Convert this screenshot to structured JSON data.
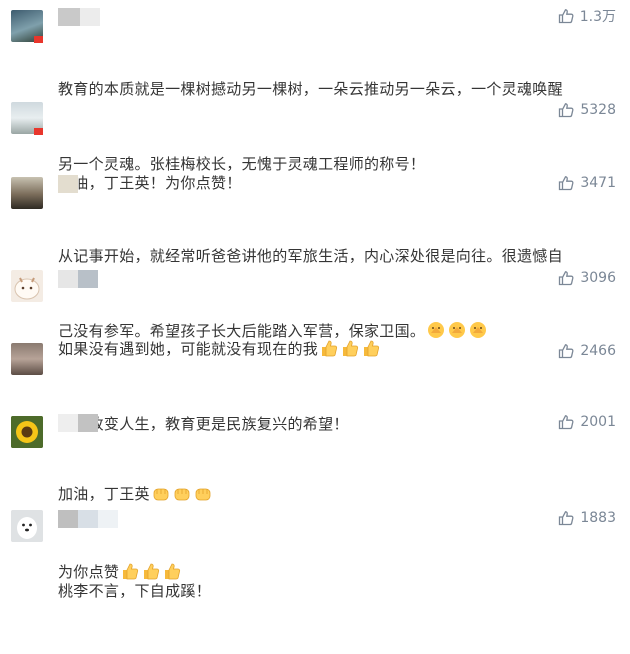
{
  "comments": [
    {
      "likes": "1.3万",
      "text": "教育的本质就是一棵树撼动另一棵树，一朵云推动另一朵云，一个灵魂唤醒另一个灵魂。张桂梅校长，无愧于灵魂工程师的称号！",
      "line1": "教育的本质就是一棵树撼动另一棵树，一朵云推动另一朵云，一个灵魂唤醒",
      "line2": "另一个灵魂。张桂梅校长，无愧于灵魂工程师的称号！"
    },
    {
      "likes": "5328",
      "line1": "加油，丁王英！为你点赞！"
    },
    {
      "likes": "3471",
      "line1": "从记事开始，就经常听爸爸讲他的军旅生活，内心深处很是向往。很遗憾自",
      "line2": "己没有参军。希望孩子长大后能踏入军营，保家卫国。",
      "emoji": "pray-emoji"
    },
    {
      "likes": "3096",
      "line1": "如果没有遇到她，可能就没有现在的我",
      "emoji": "thumbs-up-emoji"
    },
    {
      "likes": "2466",
      "line1": "教育改变人生，教育更是民族复兴的希望！"
    },
    {
      "likes": "2001",
      "line1": "加油，丁王英",
      "line2": "为你点赞",
      "emoji1": "fist-emoji",
      "emoji2": "thumbs-up-emoji"
    },
    {
      "likes": "1883",
      "line1": "桃李不言，下自成蹊！"
    }
  ],
  "colors": {
    "likes": "#7b8796",
    "text": "#353535",
    "flag": "#e8362c"
  },
  "icons": {
    "like": "thumbs-up-outline-icon"
  }
}
